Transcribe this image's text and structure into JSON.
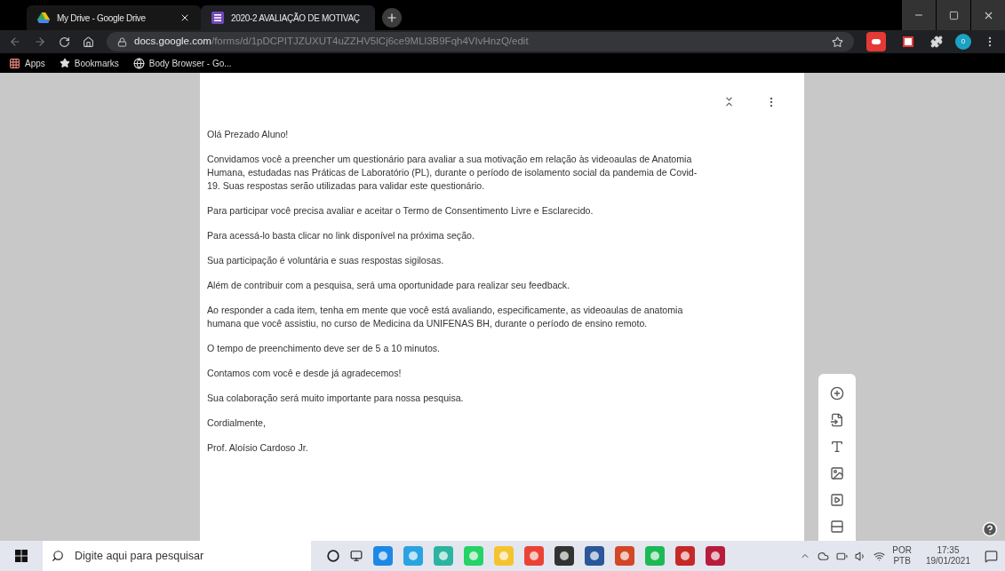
{
  "tabs": [
    {
      "title": "My Drive - Google Drive",
      "selected": false
    },
    {
      "title": "2020-2 AVALIAÇÃO DE MOTIVAÇ",
      "selected": true
    }
  ],
  "address_bar": {
    "domain": "docs.google.com",
    "path": "/forms/d/1pDCPITJZUXUT4uZZHV5lCj6ce9MLl3B9Fqh4VIvHnzQ/edit"
  },
  "profile": {
    "initial": "0"
  },
  "bookmarks": [
    {
      "label": "Apps"
    },
    {
      "label": "Bookmarks"
    },
    {
      "label": "Body Browser - Go..."
    }
  ],
  "form": {
    "paragraphs": [
      "Olá Prezado Aluno!",
      "Convidamos você a preencher um questionário para avaliar a sua motivação em relação às videoaulas de Anatomia Humana, estudadas nas Práticas de Laboratório (PL), durante o período de isolamento social da pandemia de Covid-19. Suas respostas serão utilizadas para validar este questionário.",
      "Para participar você precisa avaliar e aceitar o Termo de Consentimento Livre e Esclarecido.",
      "Para acessá-lo basta clicar no link disponível na próxima seção.",
      "Sua participação é voluntária e suas respostas sigilosas.",
      "Além de contribuir com a pesquisa, será uma oportunidade para realizar seu feedback.",
      "Ao responder a cada item, tenha em mente que você está avaliando, especificamente, as videoaulas de anatomia humana que você assistiu, no curso de Medicina da UNIFENAS BH, durante o período de ensino remoto.",
      "O tempo de preenchimento deve ser de 5 a 10 minutos.",
      "Contamos com você e desde já agradecemos!",
      "Sua colaboração será muito importante para nossa pesquisa.",
      "Cordialmente,",
      "Prof. Aloísio Cardoso Jr."
    ]
  },
  "taskbar": {
    "search": {
      "placeholder": "Digite aqui para pesquisar"
    },
    "language": "POR",
    "layout": "PTB",
    "time": "17:35",
    "date": "19/01/2021"
  }
}
